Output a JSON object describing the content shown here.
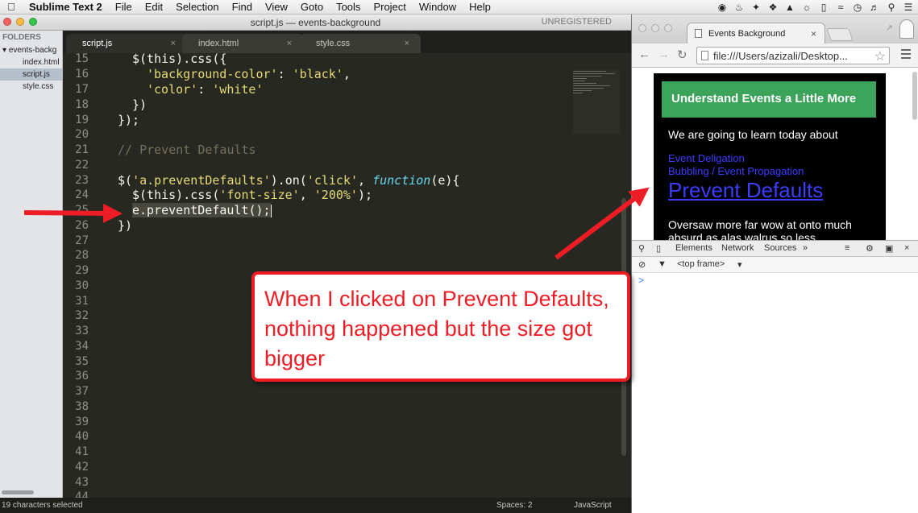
{
  "menubar": {
    "app_name": "Sublime Text 2",
    "items": [
      "File",
      "Edit",
      "Selection",
      "Find",
      "View",
      "Goto",
      "Tools",
      "Project",
      "Window",
      "Help"
    ]
  },
  "sublime": {
    "title": "script.js — events-background",
    "unregistered": "UNREGISTERED",
    "sidebar": {
      "header": "FOLDERS",
      "folder": "events-backg",
      "files": [
        "index.html",
        "script.js",
        "style.css"
      ],
      "selected": "script.js"
    },
    "tabs": [
      {
        "label": "script.js",
        "close": "×"
      },
      {
        "label": "index.html",
        "close": "×"
      },
      {
        "label": "style.css",
        "close": "×"
      }
    ],
    "line_numbers": [
      "15",
      "16",
      "17",
      "18",
      "19",
      "20",
      "21",
      "22",
      "23",
      "24",
      "25",
      "26",
      "27",
      "28",
      "29",
      "30",
      "31",
      "32",
      "33",
      "34",
      "35",
      "36",
      "37",
      "38",
      "39",
      "40",
      "41",
      "42",
      "43",
      "44"
    ],
    "code": {
      "l15": "$(this).css({",
      "l16_key": "'background-color'",
      "l16_val": "'black'",
      "l17_key": "'color'",
      "l17_val": "'white'",
      "l18": "})",
      "l19": "});",
      "l21": "// Prevent Defaults",
      "l23_sel": "'a.preventDefaults'",
      "l23_evt": "'click'",
      "l23_fn": "function",
      "l23_arg": "(e){",
      "l24_key": "'font-size'",
      "l24_val": "'200%'",
      "l25": "e.preventDefault();",
      "l26": "})"
    },
    "status_left": "19 characters selected",
    "status_spaces": "Spaces: 2",
    "status_syntax": "JavaScript"
  },
  "chrome": {
    "tab_title": "Events Background",
    "tab_close": "×",
    "address": "file:///Users/azizali/Desktop...",
    "page": {
      "banner": "Understand Events a Little More",
      "intro": "We are going to learn today about",
      "link1": "Event Deligation",
      "link2": "Bubbling / Event Propagation",
      "link3": "Prevent Defaults",
      "para": "Oversaw more far wow at onto much absurd as alas walrus so less"
    },
    "devtools": {
      "tabs": [
        "Elements",
        "Network",
        "Sources"
      ],
      "more": "»",
      "frame": "<top frame>",
      "prompt": ">"
    }
  },
  "annotation": {
    "text": "When I clicked on Prevent Defaults, nothing happened but the size got bigger",
    "color": "#ee1c24"
  },
  "colors": {
    "editor_bg": "#272822",
    "string": "#e6db74",
    "comment": "#75715e",
    "keyword": "#66d9ef",
    "banner": "#3ba35a",
    "link": "#3d3dff"
  }
}
